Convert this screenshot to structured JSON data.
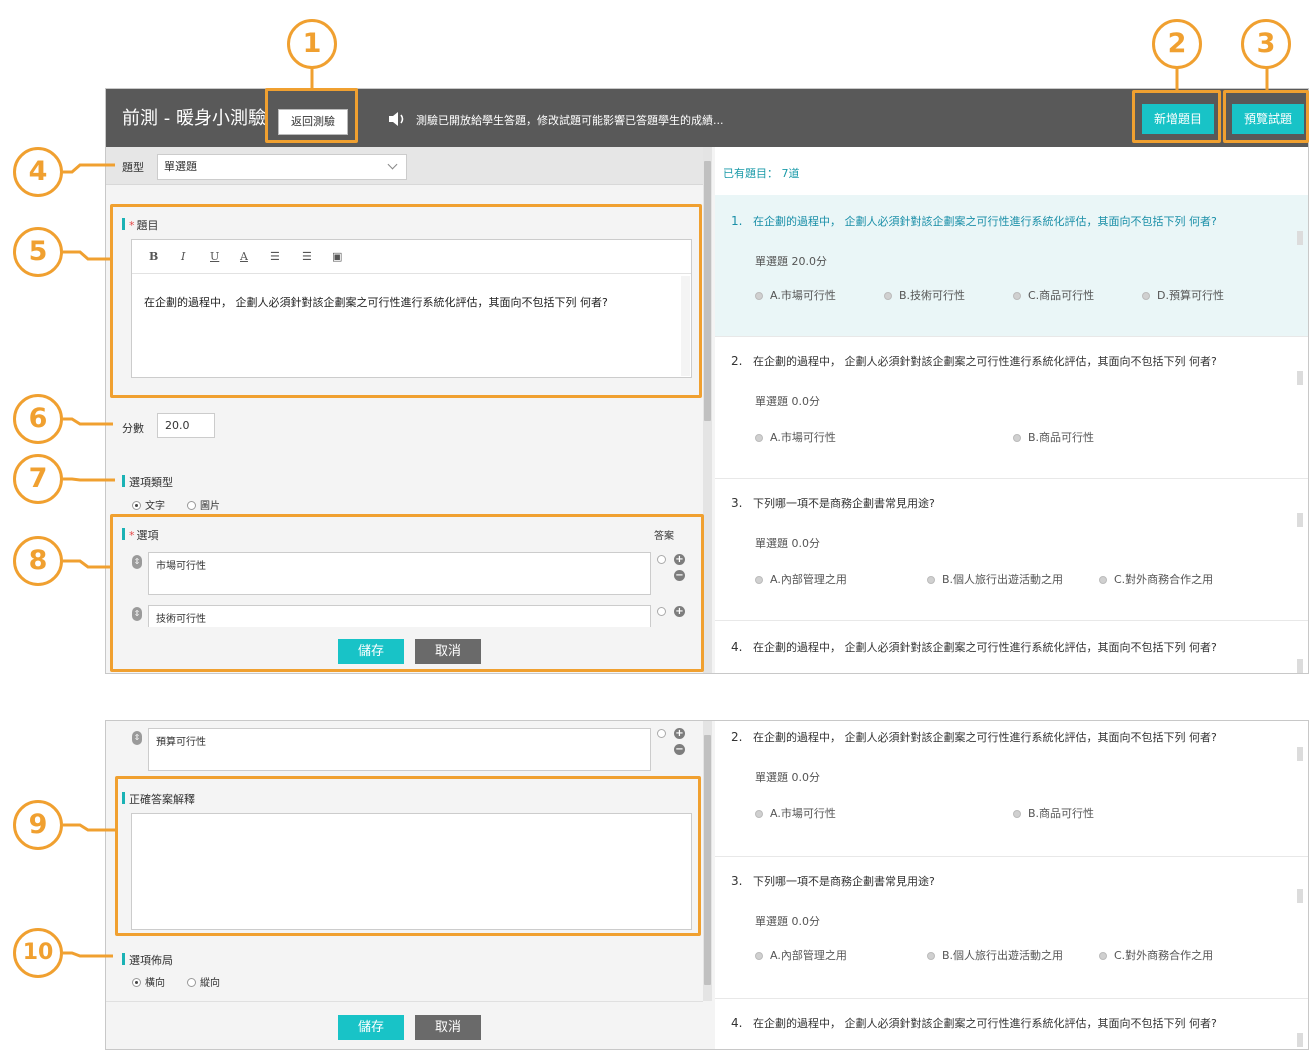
{
  "header": {
    "title": "前測 - 暖身小測驗",
    "back_button": "返回測驗",
    "notice": "測驗已開放給學生答題，修改試題可能影響已答題學生的成績...",
    "add_question_button": "新增題目",
    "preview_button": "預覽試題"
  },
  "callouts": [
    "1",
    "2",
    "3",
    "4",
    "5",
    "6",
    "7",
    "8",
    "9",
    "10"
  ],
  "editor": {
    "type_label": "題型",
    "type_value": "單選題",
    "question_label": "題目",
    "toolbar": [
      "B",
      "I",
      "U",
      "A",
      "list-ordered-icon",
      "list-bullet-icon",
      "image-icon"
    ],
    "question_text": "在企劃的過程中， 企劃人必須針對該企劃案之可行性進行系統化評估，其面向不包括下列 何者?",
    "score_label": "分數",
    "score_value": "20.0",
    "option_type_label": "選項類型",
    "option_type_text": "文字",
    "option_type_image": "圖片",
    "options_label": "選項",
    "answer_label": "答案",
    "options": [
      "市場可行性",
      "技術可行性",
      "預算可行性"
    ],
    "explanation_label": "正確答案解釋",
    "layout_label": "選項佈局",
    "layout_horizontal": "橫向",
    "layout_vertical": "縱向",
    "save_button": "儲存",
    "cancel_button": "取消"
  },
  "question_list": {
    "count_text": "已有題目： 7道",
    "questions": [
      {
        "num": "1.",
        "text": "在企劃的過程中， 企劃人必須針對該企劃案之可行性進行系統化評估，其面向不包括下列 何者?",
        "meta": "單選題 20.0分",
        "options": [
          "A.市場可行性",
          "B.技術可行性",
          "C.商品可行性",
          "D.預算可行性"
        ]
      },
      {
        "num": "2.",
        "text": "在企劃的過程中， 企劃人必須針對該企劃案之可行性進行系統化評估，其面向不包括下列 何者?",
        "meta": "單選題 0.0分",
        "options": [
          "A.市場可行性",
          "B.商品可行性"
        ]
      },
      {
        "num": "3.",
        "text": "下列哪一項不是商務企劃書常見用途?",
        "meta": "單選題 0.0分",
        "options": [
          "A.內部管理之用",
          "B.個人旅行出遊活動之用",
          "C.對外商務合作之用"
        ]
      },
      {
        "num": "4.",
        "text": "在企劃的過程中， 企劃人必須針對該企劃案之可行性進行系統化評估，其面向不包括下列 何者?"
      }
    ]
  }
}
